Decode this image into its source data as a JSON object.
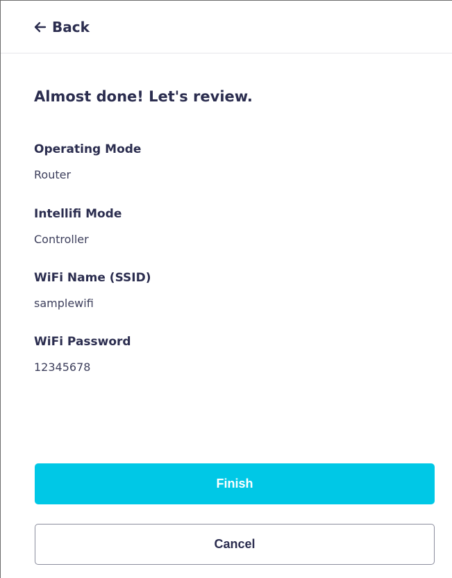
{
  "header": {
    "back_label": "Back"
  },
  "page": {
    "title": "Almost done! Let's review."
  },
  "review": [
    {
      "label": "Operating Mode",
      "value": "Router"
    },
    {
      "label": "Intellifi Mode",
      "value": "Controller"
    },
    {
      "label": "WiFi Name (SSID)",
      "value": "samplewifi"
    },
    {
      "label": "WiFi Password",
      "value": "12345678"
    }
  ],
  "actions": {
    "finish_label": "Finish",
    "cancel_label": "Cancel"
  },
  "colors": {
    "primary": "#00c8e6",
    "text": "#2b2d4f"
  },
  "icons": {
    "back": "arrow-left-icon"
  }
}
